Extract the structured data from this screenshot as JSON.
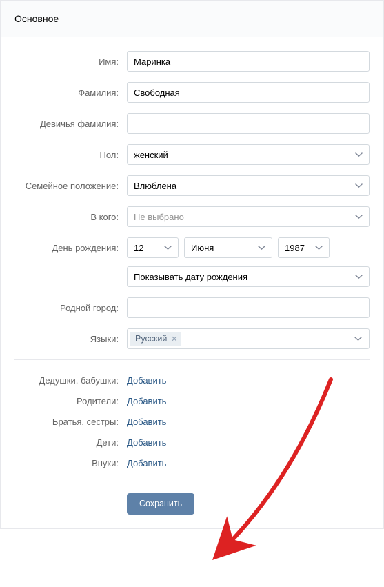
{
  "header": {
    "title": "Основное"
  },
  "fields": {
    "firstName": {
      "label": "Имя:",
      "value": "Маринка"
    },
    "lastName": {
      "label": "Фамилия:",
      "value": "Свободная"
    },
    "maidenName": {
      "label": "Девичья фамилия:",
      "value": ""
    },
    "gender": {
      "label": "Пол:",
      "value": "женский"
    },
    "relationship": {
      "label": "Семейное положение:",
      "value": "Влюблена"
    },
    "partner": {
      "label": "В кого:",
      "value": "Не выбрано"
    },
    "birthday": {
      "label": "День рождения:",
      "day": "12",
      "month": "Июня",
      "year": "1987",
      "visibility": "Показывать дату рождения"
    },
    "hometown": {
      "label": "Родной город:",
      "value": ""
    },
    "languages": {
      "label": "Языки:",
      "tags": [
        "Русский"
      ]
    }
  },
  "relatives": {
    "grandparents": {
      "label": "Дедушки, бабушки:",
      "action": "Добавить"
    },
    "parents": {
      "label": "Родители:",
      "action": "Добавить"
    },
    "siblings": {
      "label": "Братья, сестры:",
      "action": "Добавить"
    },
    "children": {
      "label": "Дети:",
      "action": "Добавить"
    },
    "grandchildren": {
      "label": "Внуки:",
      "action": "Добавить"
    }
  },
  "actions": {
    "save": "Сохранить"
  }
}
